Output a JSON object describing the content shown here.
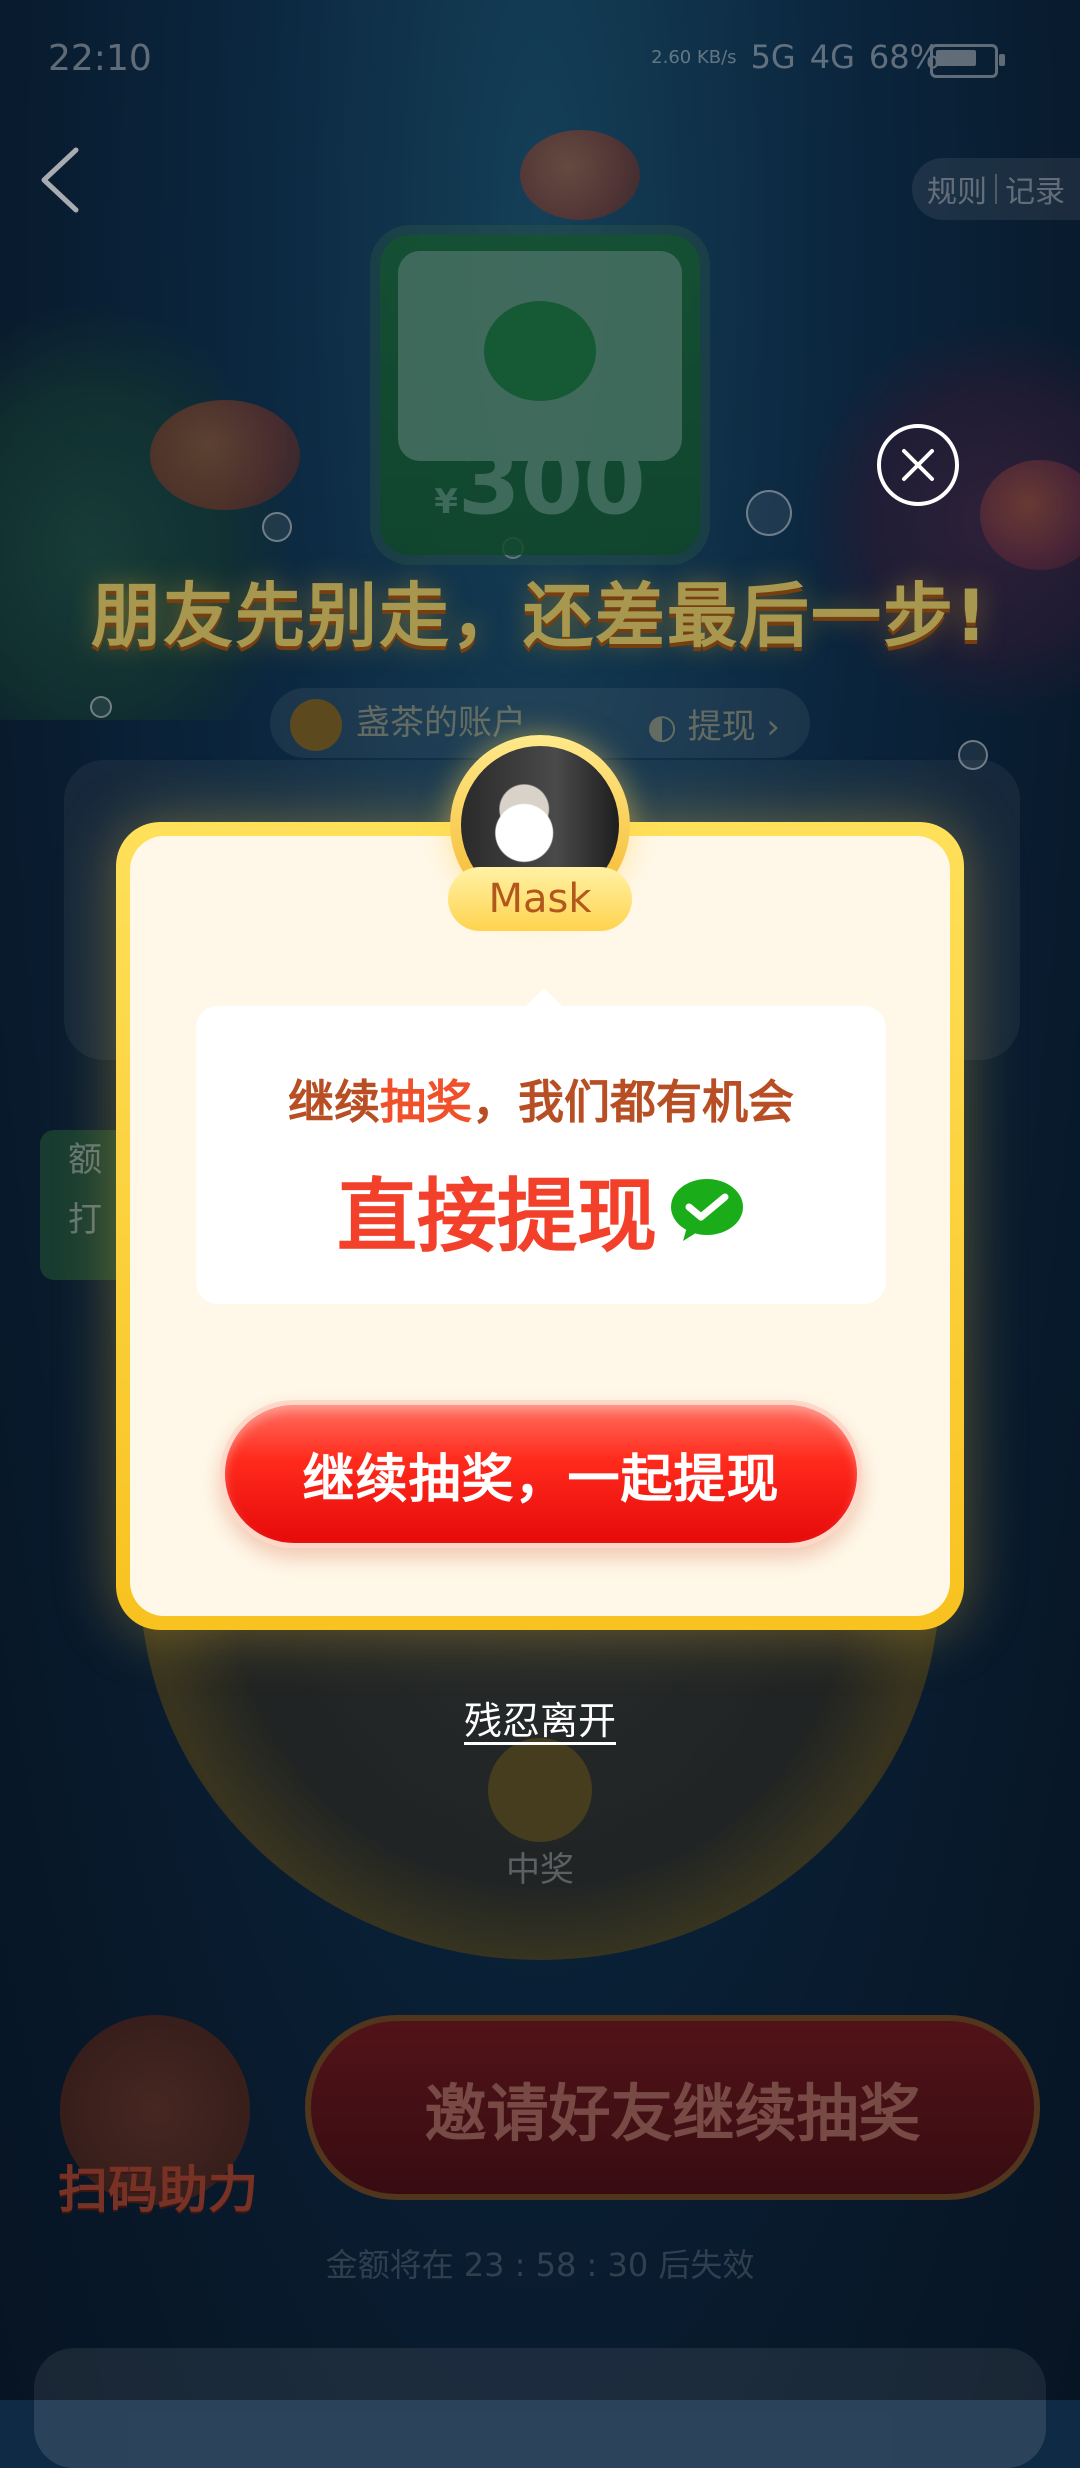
{
  "status_bar": {
    "time": "22:10",
    "net_speed": "2.60 KB/s",
    "signal_1": "5G",
    "signal_2": "4G",
    "battery": "68%"
  },
  "header": {
    "rules_label": "规则",
    "records_label": "记录"
  },
  "background": {
    "prize_currency": "¥",
    "prize_amount": "300",
    "headline": "朋友先别走，还差最后一步!",
    "account_label": "盏茶的账户",
    "withdraw_label": "提现",
    "side_card_top": "额",
    "side_card_bottom": "打",
    "wheel_center_text": "中奖",
    "scan_label": "扫码助力",
    "invite_button": "邀请好友继续抽奖",
    "expire_text": "金额将在 23 : 58 : 30 后失效"
  },
  "modal": {
    "friend_name": "Mask",
    "message_line1_a": "继续",
    "message_line1_b": "抽奖",
    "message_line1_c": "，我们都有机会",
    "message_big": "直接提现",
    "continue_button": "继续抽奖，一起提现",
    "leave_link": "残忍离开"
  },
  "icons": {
    "back": "chevron-left-icon",
    "close": "close-icon",
    "wechat": "wechat-pay-icon"
  },
  "colors": {
    "headline": "#ffe26a",
    "modal_border": "#f8c21f",
    "modal_bg": "#fff8e9",
    "primary_button": "#ff2a1c",
    "message_accent": "#f2402a",
    "wechat_green": "#1aad19"
  }
}
